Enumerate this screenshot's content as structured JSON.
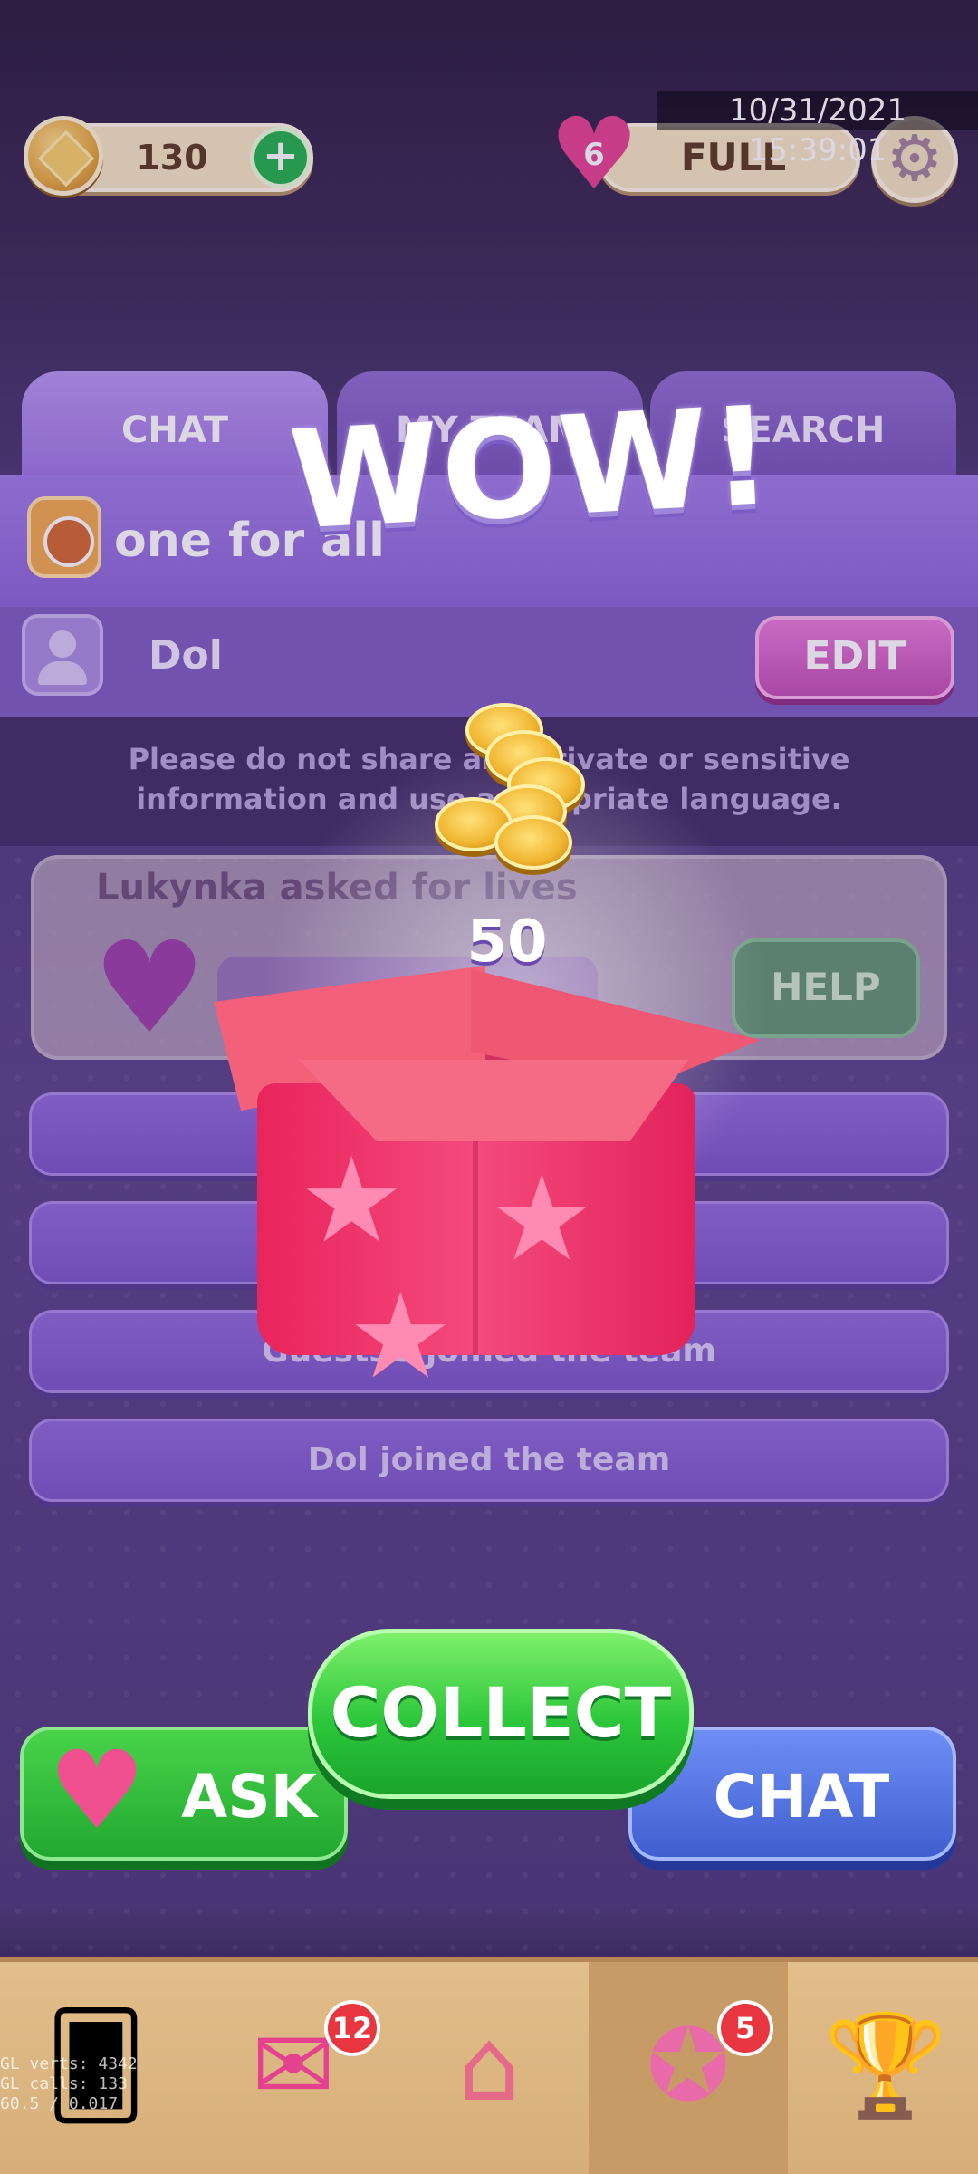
{
  "hud": {
    "coins": "130",
    "plus": "+",
    "lives_count": "6",
    "lives_status": "FULL",
    "timestamp": "10/31/2021 15:39:01"
  },
  "tabs": [
    {
      "label": "CHAT",
      "active": true
    },
    {
      "label": "MY TEAM",
      "active": false
    },
    {
      "label": "SEARCH",
      "active": false
    }
  ],
  "team": {
    "name": "one for all"
  },
  "user": {
    "name": "Dol",
    "edit_label": "EDIT"
  },
  "notice": "Please do not share any private or sensitive information and use appropriate language.",
  "request": {
    "title": "Lukynka asked for lives",
    "help_label": "HELP"
  },
  "messages": [
    "",
    "",
    "Guest38 joined the team",
    "Dol joined the team"
  ],
  "popup": {
    "headline": "WOW!",
    "reward_amount": "50",
    "collect_label": "COLLECT"
  },
  "actions": {
    "ask_label": "ASK",
    "chat_label": "CHAT"
  },
  "nav": {
    "items": [
      {
        "name": "cards",
        "icon": "cards-icon"
      },
      {
        "name": "inbox",
        "icon": "love-letter-icon",
        "badge": "12"
      },
      {
        "name": "home",
        "icon": "house-icon"
      },
      {
        "name": "team",
        "icon": "team-icon",
        "badge": "5",
        "active": true
      },
      {
        "name": "leaderboard",
        "icon": "trophy-icon"
      }
    ]
  },
  "debug": {
    "line1": "GL verts: 4342",
    "line2": "GL calls: 133",
    "line3": "60.5 / 0.017"
  },
  "colors": {
    "accent_purple": "#8a65d6",
    "collect_green": "#2cc63b",
    "chat_blue": "#3f5fd0",
    "gift_pink": "#e9245c"
  }
}
